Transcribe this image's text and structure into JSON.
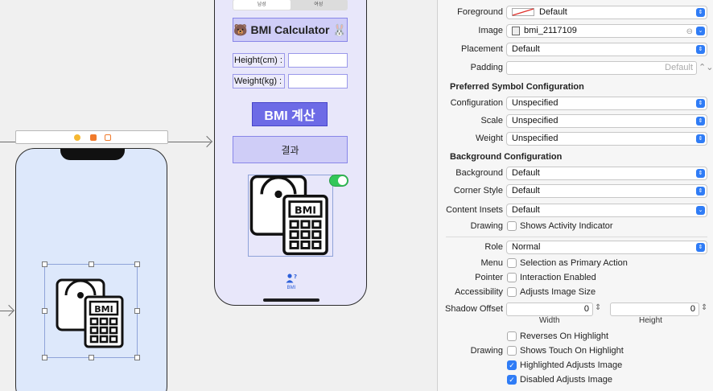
{
  "canvas": {
    "segment": {
      "left": "남성",
      "right": "여성"
    },
    "title": "🐻 BMI Calculator 🐰",
    "height_label": "Height(cm) :",
    "weight_label": "Weight(kg) :",
    "calc_button": "BMI 계산",
    "result_label": "결과",
    "tab_label": "BMI",
    "bmi_text": "BMI"
  },
  "inspector": {
    "foreground": {
      "label": "Foreground",
      "value": "Default"
    },
    "image": {
      "label": "Image",
      "value": "bmi_2117109"
    },
    "placement": {
      "label": "Placement",
      "value": "Default"
    },
    "padding": {
      "label": "Padding",
      "placeholder": "Default"
    },
    "symbol_section": "Preferred Symbol Configuration",
    "configuration": {
      "label": "Configuration",
      "value": "Unspecified"
    },
    "scale": {
      "label": "Scale",
      "value": "Unspecified"
    },
    "weight": {
      "label": "Weight",
      "value": "Unspecified"
    },
    "background_section": "Background Configuration",
    "background": {
      "label": "Background",
      "value": "Default"
    },
    "corner_style": {
      "label": "Corner Style",
      "value": "Default"
    },
    "content_insets": {
      "label": "Content Insets",
      "value": "Default"
    },
    "drawing1": {
      "label": "Drawing",
      "option": "Shows Activity Indicator",
      "checked": false
    },
    "role": {
      "label": "Role",
      "value": "Normal"
    },
    "menu": {
      "label": "Menu",
      "option": "Selection as Primary Action",
      "checked": false
    },
    "pointer": {
      "label": "Pointer",
      "option": "Interaction Enabled",
      "checked": false
    },
    "accessibility": {
      "label": "Accessibility",
      "option": "Adjusts Image Size",
      "checked": false
    },
    "shadow_offset": {
      "label": "Shadow Offset",
      "width_value": "0",
      "height_value": "0",
      "width_label": "Width",
      "height_label": "Height"
    },
    "reverses": {
      "option": "Reverses On Highlight",
      "checked": false
    },
    "drawing2": {
      "label": "Drawing",
      "option": "Shows Touch On Highlight",
      "checked": false
    },
    "highlighted": {
      "option": "Highlighted Adjusts Image",
      "checked": true
    },
    "disabled": {
      "option": "Disabled Adjusts Image",
      "checked": true
    }
  },
  "colors": {
    "accent": "#2f7cf6",
    "button": "#6d6be6",
    "toggle": "#33c759"
  }
}
